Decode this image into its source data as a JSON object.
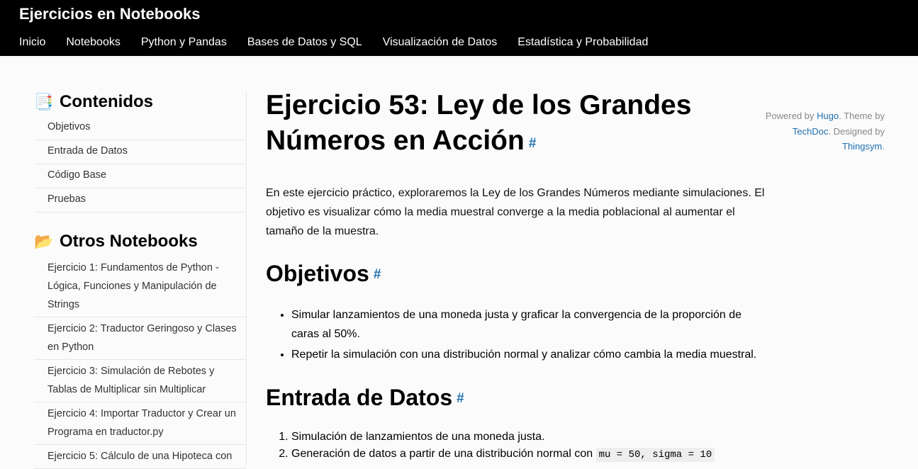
{
  "site": {
    "title": "Ejercicios en Notebooks"
  },
  "nav": [
    "Inicio",
    "Notebooks",
    "Python y Pandas",
    "Bases de Datos y SQL",
    "Visualización de Datos",
    "Estadística y Probabilidad"
  ],
  "sidebar": {
    "toc_icon": "📑",
    "toc_heading": "Contenidos",
    "toc": [
      "Objetivos",
      "Entrada de Datos",
      "Código Base",
      "Pruebas"
    ],
    "others_icon": "📂",
    "others_heading": "Otros Notebooks",
    "others": [
      "Ejercicio 1: Fundamentos de Python - Lógica, Funciones y Manipulación de Strings",
      "Ejercicio 2: Traductor Geringoso y Clases en Python",
      "Ejercicio 3: Simulación de Rebotes y Tablas de Multiplicar sin Multiplicar",
      "Ejercicio 4: Importar Traductor y Crear un Programa en traductor.py",
      "Ejercicio 5: Cálculo de una Hipoteca con"
    ]
  },
  "main": {
    "title": "Ejercicio 53: Ley de los Grandes Números en Acción",
    "anchor": "#",
    "intro": "En este ejercicio práctico, exploraremos la Ley de los Grandes Números mediante simulaciones. El objetivo es visualizar cómo la media muestral converge a la media poblacional al aumentar el tamaño de la muestra.",
    "objetivos_heading": "Objetivos",
    "objetivos": [
      "Simular lanzamientos de una moneda justa y graficar la convergencia de la proporción de caras al 50%.",
      "Repetir la simulación con una distribución normal y analizar cómo cambia la media muestral."
    ],
    "entrada_heading": "Entrada de Datos",
    "entrada": [
      "Simulación de lanzamientos de una moneda justa.",
      "Generación de datos a partir de una distribución normal con"
    ],
    "entrada_code": "mu = 50, sigma = 10"
  },
  "credits": {
    "powered_prefix": "Powered by ",
    "hugo": "Hugo",
    "theme_prefix": ". Theme by ",
    "techdoc": "TechDoc",
    "designed_prefix": ". Designed by ",
    "thingsym": "Thingsym",
    "suffix": "."
  }
}
